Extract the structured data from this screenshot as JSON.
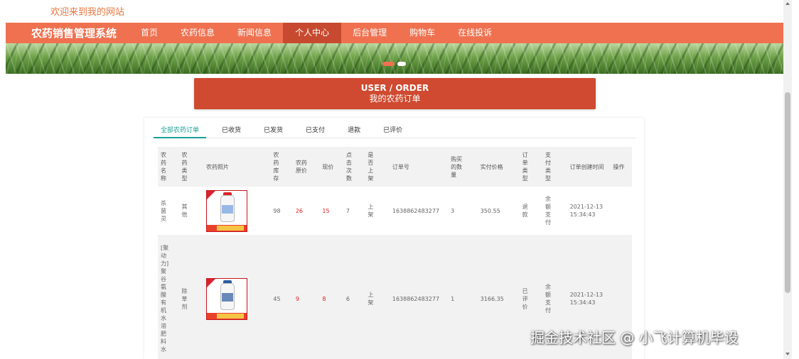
{
  "welcome": "欢迎来到我的网站",
  "nav": {
    "brand": "农药销售管理系统",
    "items": [
      "首页",
      "农药信息",
      "新闻信息",
      "个人中心",
      "后台管理",
      "购物车",
      "在线投诉"
    ],
    "active_index": 3
  },
  "banner": {
    "carousel_dots": 2,
    "active_dot": 0
  },
  "order_header": {
    "en": "USER / ORDER",
    "cn": "我的农药订单"
  },
  "tabs": [
    "全部农药订单",
    "已收货",
    "已发货",
    "已支付",
    "退款",
    "已评价"
  ],
  "table": {
    "headers": [
      "农药名称",
      "农药类型",
      "农药照片",
      "农药库存",
      "农药原价",
      "现价",
      "点击次数",
      "是否上架",
      "订单号",
      "购买的数量",
      "实付价格",
      "订单类型",
      "支付类型",
      "订单创建时间",
      "操作"
    ],
    "rows": [
      {
        "name": "杀菌灵",
        "type": "其他",
        "photo": "pesticide-bottle-red-icon",
        "stock": "98",
        "original_price": "26",
        "price": "15",
        "clicks": "7",
        "listed": "上架",
        "order_no": "1638862483277",
        "quantity": "3",
        "paid": "350.55",
        "order_type": "退款",
        "pay_type": "余额支付",
        "created": "2021-12-13 15:34:43",
        "action": ""
      },
      {
        "name": "[聚动力]聚谷氨酸有机水溶肥料水",
        "type": "除草剂",
        "photo": "pesticide-bottle-blue-icon",
        "stock": "45",
        "original_price": "9",
        "price": "8",
        "clicks": "6",
        "listed": "上架",
        "order_no": "1638862483277",
        "quantity": "1",
        "paid": "3166.35",
        "order_type": "已评价",
        "pay_type": "余额支付",
        "created": "2021-12-13 15:34:43",
        "action": ""
      }
    ]
  },
  "watermark": "掘金技术社区 @ 小飞计算机毕设",
  "colors": {
    "nav_bg": "#ef7150",
    "nav_active": "#c74a30",
    "header_bg": "#cf4a30",
    "tab_active": "#1aa094",
    "price_red": "#e02020",
    "welcome_text": "#e8763f"
  }
}
